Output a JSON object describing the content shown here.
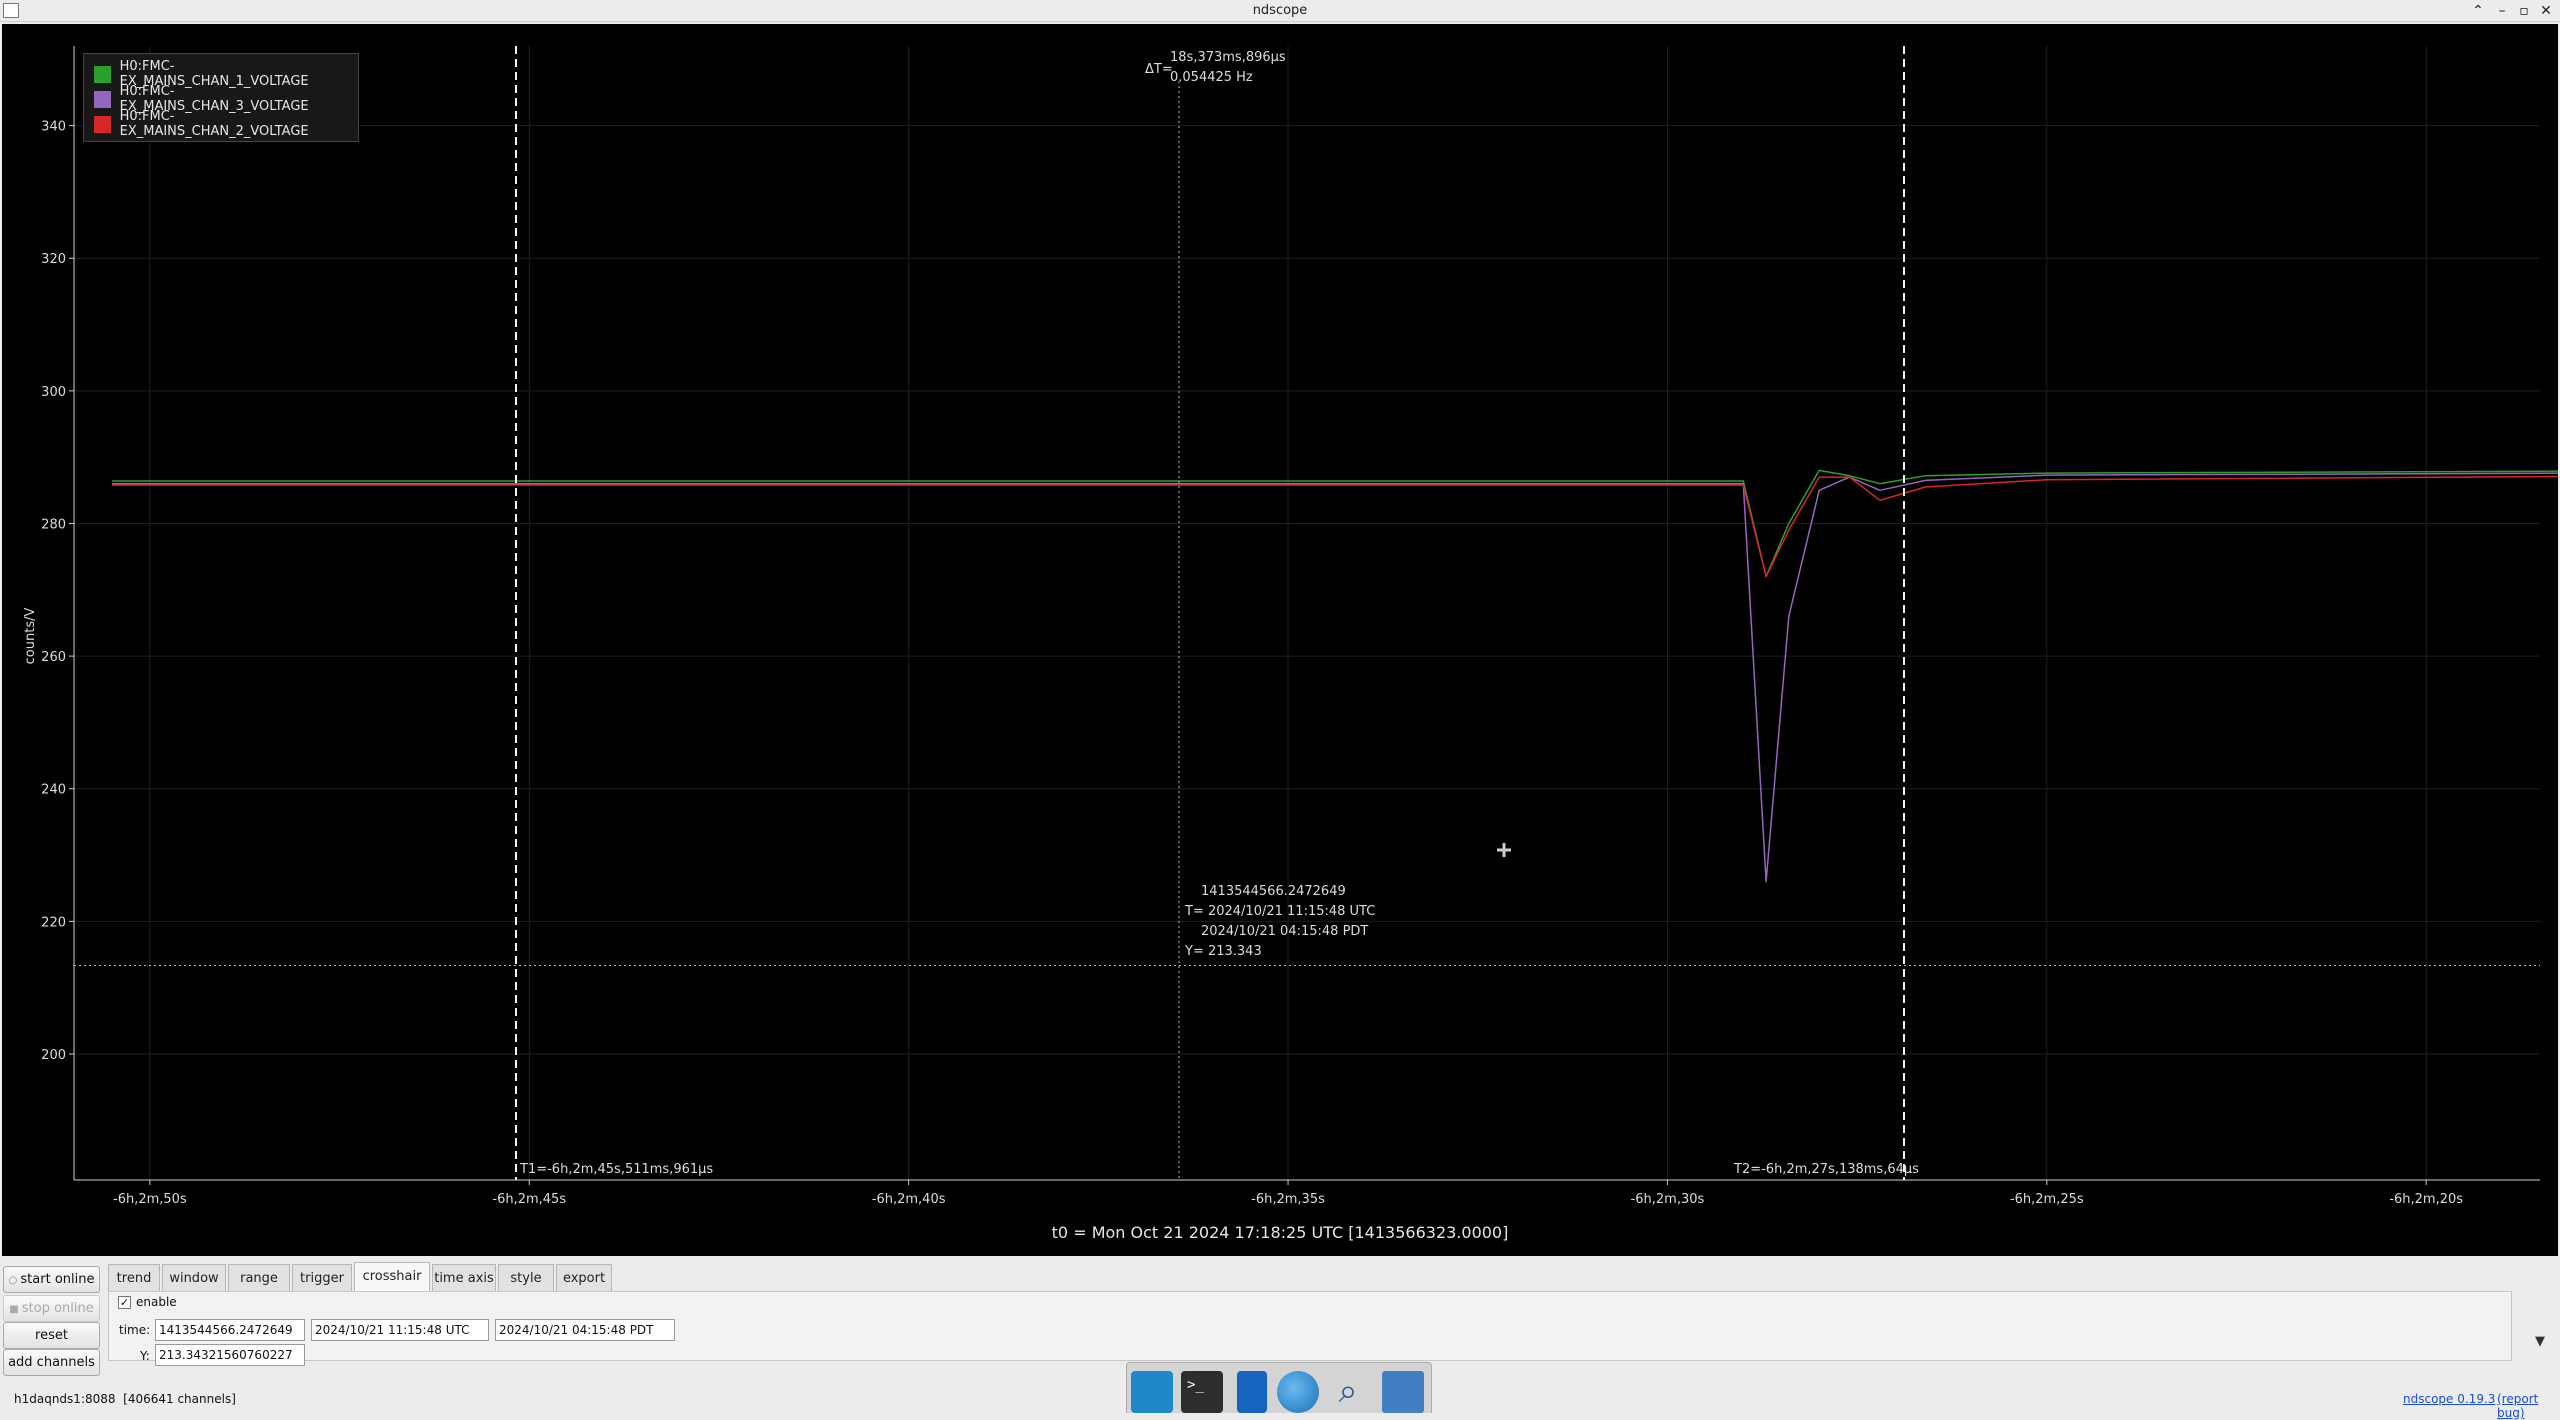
{
  "window": {
    "title": "ndscope"
  },
  "plot": {
    "legend": [
      {
        "label": "H0:FMC-EX_MAINS_CHAN_1_VOLTAGE",
        "color": "#2ca02c"
      },
      {
        "label": "H0:FMC-EX_MAINS_CHAN_3_VOLTAGE",
        "color": "#9467bd"
      },
      {
        "label": "H0:FMC-EX_MAINS_CHAN_2_VOLTAGE",
        "color": "#d62728"
      }
    ],
    "y_axis_label": "counts/V",
    "y_ticks": [
      "340",
      "320",
      "300",
      "280",
      "260",
      "240",
      "220",
      "200"
    ],
    "x_ticks": [
      "-6h,2m,50s",
      "-6h,2m,45s",
      "-6h,2m,40s",
      "-6h,2m,35s",
      "-6h,2m,30s",
      "-6h,2m,25s",
      "-6h,2m,20s"
    ],
    "cursor_t1": "T1=-6h,2m,45s,511ms,961µs",
    "cursor_t2": "T2=-6h,2m,27s,138ms,64µs",
    "delta_t_label": "ΔT=",
    "delta_t_value": "18s,373ms,896µs",
    "delta_t_freq": "0.054425 Hz",
    "crosshair_gps": "1413544566.2472649",
    "crosshair_utc": "T= 2024/10/21 11:15:48 UTC",
    "crosshair_pdt": "2024/10/21 04:15:48 PDT",
    "crosshair_y": "Y= 213.343",
    "t0_label": "t0 = Mon Oct 21 2024 17:18:25 UTC [1413566323.0000]"
  },
  "chart_data": {
    "type": "line",
    "title": "",
    "xlabel": "",
    "ylabel": "counts/V",
    "ylim": [
      181,
      352
    ],
    "xlim": [
      "-6h,2m,51s",
      "-6h,2m,18.5s"
    ],
    "x_ticks": [
      "-6h,2m,50s",
      "-6h,2m,45s",
      "-6h,2m,40s",
      "-6h,2m,35s",
      "-6h,2m,30s",
      "-6h,2m,25s",
      "-6h,2m,20s"
    ],
    "x_seconds_relative_to_t0": [
      -21770.5,
      -21749.0,
      -21748.7,
      -21748.4,
      -21748.0,
      -21747.6,
      -21747.2,
      -21746.6,
      -21745.0,
      -21738.0
    ],
    "series": [
      {
        "name": "H0:FMC-EX_MAINS_CHAN_1_VOLTAGE",
        "color": "#2ca02c",
        "values": [
          286.4,
          286.4,
          272.0,
          280.0,
          288.0,
          287.2,
          286.0,
          287.2,
          287.6,
          287.9
        ]
      },
      {
        "name": "H0:FMC-EX_MAINS_CHAN_3_VOLTAGE",
        "color": "#9467bd",
        "values": [
          286.0,
          286.0,
          226.0,
          266.0,
          285.0,
          287.0,
          285.0,
          286.5,
          287.3,
          287.6
        ]
      },
      {
        "name": "H0:FMC-EX_MAINS_CHAN_2_VOLTAGE",
        "color": "#d62728",
        "values": [
          285.8,
          285.8,
          272.0,
          279.0,
          287.0,
          287.0,
          283.5,
          285.5,
          286.6,
          287.1
        ]
      }
    ],
    "grid": true,
    "legend": "top-left"
  },
  "controls": {
    "buttons": {
      "start_online": "start online",
      "stop_online": "stop online",
      "reset": "reset",
      "add_channels": "add channels"
    },
    "tabs": [
      "trend",
      "window",
      "range",
      "trigger",
      "crosshair",
      "time axis",
      "style",
      "export"
    ],
    "active_tab": "crosshair",
    "crosshair": {
      "enable_label": "enable",
      "time_label": "time:",
      "time_gps": "1413544566.2472649",
      "time_utc": "2024/10/21 11:15:48 UTC",
      "time_pdt": "2024/10/21 04:15:48 PDT",
      "y_label": "Y:",
      "y_value": "213.34321560760227"
    }
  },
  "status": {
    "server": "h1daqnds1:8088  [406641 channels]",
    "version_link": "ndscope 0.19.3",
    "report_bug": "(report bug)"
  }
}
